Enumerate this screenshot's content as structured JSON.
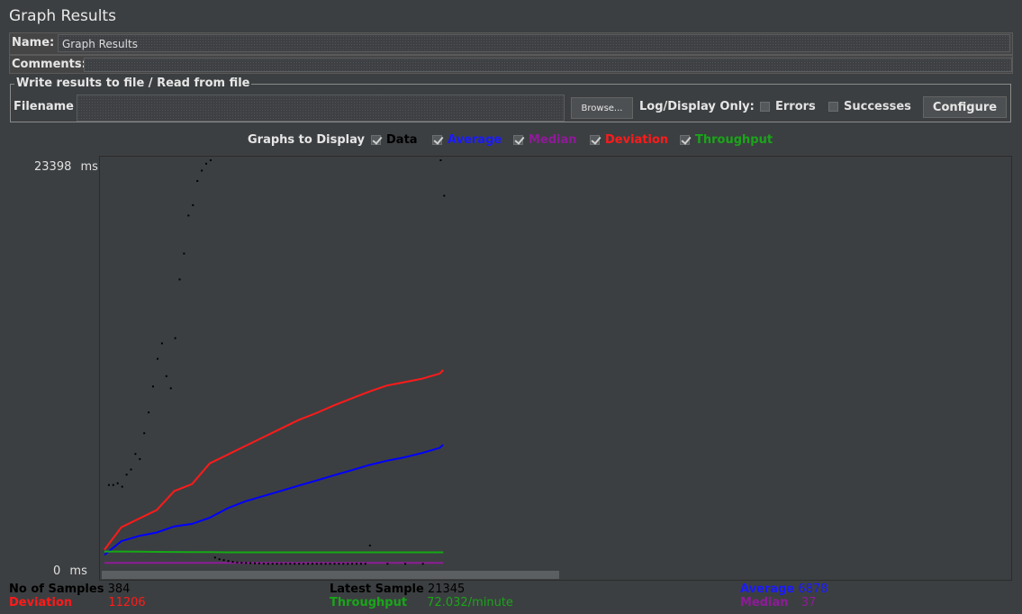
{
  "window": {
    "title": "Graph Results"
  },
  "name_row": {
    "label": "Name:",
    "value": "Graph Results"
  },
  "comments_row": {
    "label": "Comments:",
    "value": ""
  },
  "file_group": {
    "legend": "Write results to file / Read from file",
    "filename_label": "Filename",
    "filename_value": "",
    "browse_label": "Browse...",
    "log_display_label": "Log/Display Only:",
    "errors_label": "Errors",
    "successes_label": "Successes",
    "configure_label": "Configure"
  },
  "graphs_to_display": {
    "label": "Graphs to Display",
    "options": [
      {
        "label": "Data",
        "color": "#000000",
        "checked": true
      },
      {
        "label": "Average",
        "color": "#0000ff",
        "checked": true
      },
      {
        "label": "Median",
        "color": "#8e1b99",
        "checked": true
      },
      {
        "label": "Deviation",
        "color": "#ff1a1a",
        "checked": true
      },
      {
        "label": "Throughput",
        "color": "#15a915",
        "checked": true
      }
    ]
  },
  "y_axis": {
    "max_label": "23398",
    "min_label": "0",
    "unit": "ms"
  },
  "stats": {
    "samples_label": "No of Samples",
    "samples_value": "384",
    "latest_label": "Latest Sample",
    "latest_value": "21345",
    "average_label": "Average",
    "average_value": "6878",
    "deviation_label": "Deviation",
    "deviation_value": "11206",
    "throughput_label": "Throughput",
    "throughput_value": "72.032/minute",
    "median_label": "Median",
    "median_value": "37"
  },
  "chart_data": {
    "type": "line",
    "ylabel": "ms",
    "ylim": [
      0,
      23398
    ],
    "x": [
      1,
      20,
      40,
      60,
      80,
      100,
      120,
      140,
      160,
      180,
      200,
      220,
      240,
      260,
      280,
      300,
      320,
      340,
      360,
      380,
      384
    ],
    "series": [
      {
        "name": "Average",
        "values": [
          500,
          1300,
          1600,
          1800,
          2150,
          2300,
          2650,
          3200,
          3600,
          3900,
          4200,
          4500,
          4800,
          5100,
          5400,
          5700,
          5950,
          6150,
          6400,
          6700,
          6878
        ]
      },
      {
        "name": "Median",
        "values": [
          37,
          37,
          37,
          37,
          37,
          37,
          37,
          37,
          37,
          37,
          37,
          37,
          37,
          37,
          37,
          37,
          37,
          37,
          37,
          37,
          37
        ]
      },
      {
        "name": "Deviation",
        "values": [
          800,
          2100,
          2600,
          3100,
          4200,
          4600,
          5800,
          6300,
          6800,
          7300,
          7800,
          8300,
          8700,
          9150,
          9550,
          9950,
          10300,
          10500,
          10700,
          11000,
          11206
        ]
      },
      {
        "name": "Throughput",
        "values": [
          700,
          700,
          690,
          680,
          670,
          660,
          660,
          650,
          650,
          650,
          650,
          650,
          650,
          650,
          650,
          650,
          650,
          650,
          650,
          650,
          650
        ]
      }
    ],
    "data_points": {
      "x": [
        5,
        10,
        15,
        20,
        25,
        30,
        35,
        40,
        45,
        50,
        55,
        60,
        65,
        70,
        75,
        80,
        85,
        90,
        95,
        100,
        105,
        110,
        115,
        120,
        125,
        130,
        135,
        140,
        145,
        150,
        155,
        160,
        165,
        170,
        175,
        180,
        185,
        190,
        195,
        200,
        205,
        210,
        215,
        220,
        225,
        230,
        235,
        240,
        245,
        250,
        255,
        260,
        265,
        270,
        275,
        280,
        285,
        290,
        295,
        300,
        320,
        340,
        360,
        380,
        384
      ],
      "y": [
        4600,
        4600,
        4700,
        4500,
        5200,
        5500,
        6400,
        6100,
        7600,
        8800,
        10300,
        11900,
        12800,
        10900,
        10200,
        13100,
        16500,
        18000,
        20200,
        20800,
        22200,
        22800,
        23200,
        23398,
        400,
        300,
        250,
        200,
        150,
        120,
        100,
        90,
        80,
        70,
        60,
        50,
        40,
        40,
        40,
        40,
        40,
        40,
        40,
        40,
        40,
        40,
        40,
        40,
        40,
        40,
        40,
        40,
        40,
        40,
        40,
        40,
        40,
        40,
        40,
        1100,
        40,
        40,
        40,
        23398,
        21345
      ]
    },
    "legend": [
      "Data",
      "Average",
      "Median",
      "Deviation",
      "Throughput"
    ]
  }
}
